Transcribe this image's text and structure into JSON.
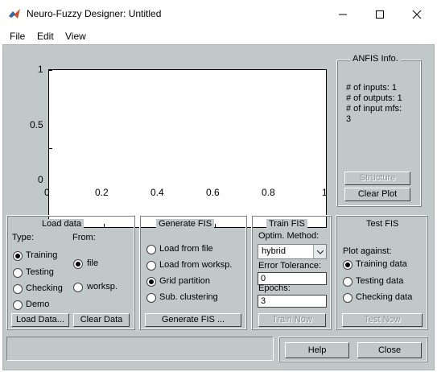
{
  "window": {
    "title": "Neuro-Fuzzy Designer: Untitled",
    "controls": [
      "minimize-icon",
      "maximize-icon",
      "close-icon"
    ]
  },
  "menu": {
    "file": "File",
    "edit": "Edit",
    "view": "View"
  },
  "plot": {
    "y_ticks": [
      "1",
      "0.5",
      "0"
    ],
    "x_ticks": [
      "0",
      "0.2",
      "0.4",
      "0.6",
      "0.8",
      "1"
    ]
  },
  "anfis_info": {
    "title": "ANFIS Info.",
    "inputs": "# of inputs: 1",
    "outputs": "# of outputs: 1",
    "input_mfs": "# of input mfs:",
    "input_mfs_value": "3",
    "structure_button": "Structure",
    "clear_plot_button": "Clear Plot"
  },
  "load_data": {
    "title": "Load data",
    "type_label": "Type:",
    "from_label": "From:",
    "types": [
      {
        "label": "Training",
        "checked": true
      },
      {
        "label": "Testing",
        "checked": false
      },
      {
        "label": "Checking",
        "checked": false
      },
      {
        "label": "Demo",
        "checked": false
      }
    ],
    "sources": [
      {
        "label": "file",
        "checked": true
      },
      {
        "label": "worksp.",
        "checked": false
      }
    ],
    "load_button": "Load Data...",
    "clear_button": "Clear Data"
  },
  "generate_fis": {
    "title": "Generate FIS",
    "options": [
      {
        "label": "Load from file",
        "checked": false
      },
      {
        "label": "Load from worksp.",
        "checked": false
      },
      {
        "label": "Grid partition",
        "checked": true
      },
      {
        "label": "Sub. clustering",
        "checked": false
      }
    ],
    "button": "Generate FIS ..."
  },
  "train_fis": {
    "title": "Train FIS",
    "optim_label": "Optim. Method:",
    "optim_value": "hybrid",
    "error_label": "Error Tolerance:",
    "error_value": "0",
    "epochs_label": "Epochs:",
    "epochs_value": "3",
    "button": "Train Now"
  },
  "test_fis": {
    "title": "Test FIS",
    "plot_against_label": "Plot against:",
    "options": [
      {
        "label": "Training data",
        "checked": true
      },
      {
        "label": "Testing data",
        "checked": false
      },
      {
        "label": "Checking data",
        "checked": false
      }
    ],
    "button": "Test Now"
  },
  "footer": {
    "help": "Help",
    "close": "Close"
  },
  "colors": {
    "panel": "#c0c8c8",
    "plot_bg": "#ffffff"
  }
}
